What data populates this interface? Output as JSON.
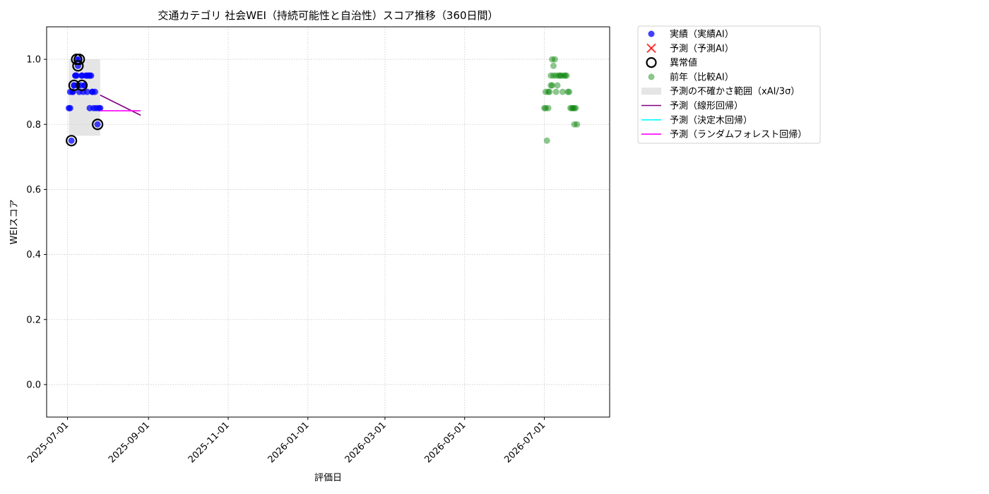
{
  "chart_data": {
    "type": "scatter",
    "title": "交通カテゴリ 社会WEI（持続可能性と自治性）スコア推移（360日間）",
    "xlabel": "評価日",
    "ylabel": "WEIスコア",
    "x_range": [
      "2025-06-15",
      "2026-08-20"
    ],
    "ylim": [
      -0.1,
      1.1
    ],
    "y_ticks": [
      0.0,
      0.2,
      0.4,
      0.6,
      0.8,
      1.0
    ],
    "y_tick_labels": [
      "0.0",
      "0.2",
      "0.4",
      "0.6",
      "0.8",
      "1.0"
    ],
    "x_ticks": [
      "2025-07-01",
      "2025-09-01",
      "2025-11-01",
      "2026-01-01",
      "2026-03-01",
      "2026-05-01",
      "2026-07-01"
    ],
    "grid": true,
    "legend_position": "outside-right",
    "legend": [
      {
        "key": "actual",
        "label": "実績（実績AI）",
        "marker": "dot",
        "color": "#0000ff"
      },
      {
        "key": "forecast",
        "label": "予測（予測AI）",
        "marker": "x",
        "color": "#ff0000"
      },
      {
        "key": "anomaly",
        "label": "異常値",
        "marker": "ring",
        "color": "#000000"
      },
      {
        "key": "prev_year",
        "label": "前年（比較AI）",
        "marker": "dot",
        "color": "#008000"
      },
      {
        "key": "band",
        "label": "予測の不確かさ範囲（xAI/3σ）",
        "marker": "rect",
        "color": "#d3d3d3"
      },
      {
        "key": "linear",
        "label": "予測（線形回帰）",
        "marker": "line",
        "color": "#800080"
      },
      {
        "key": "tree",
        "label": "予測（決定木回帰）",
        "marker": "line",
        "color": "#00ffff"
      },
      {
        "key": "forest",
        "label": "予測（ランダムフォレスト回帰）",
        "marker": "line",
        "color": "#ff00ff"
      }
    ],
    "series": [
      {
        "key": "actual",
        "name": "実績（実績AI）",
        "color": "#0000ff",
        "x": [
          "2025-07-02",
          "2025-07-03",
          "2025-07-04",
          "2025-07-05",
          "2025-07-06",
          "2025-07-07",
          "2025-07-08",
          "2025-07-09",
          "2025-07-10",
          "2025-07-11",
          "2025-07-12",
          "2025-07-13",
          "2025-07-14",
          "2025-07-15",
          "2025-07-16",
          "2025-07-17",
          "2025-07-18",
          "2025-07-19",
          "2025-07-20",
          "2025-07-21",
          "2025-07-22",
          "2025-07-23",
          "2025-07-24",
          "2025-07-25",
          "2025-07-26",
          "2025-07-03",
          "2025-07-05",
          "2025-07-06",
          "2025-07-07",
          "2025-07-08",
          "2025-07-09",
          "2025-07-10",
          "2025-07-12",
          "2025-07-14",
          "2025-07-16",
          "2025-07-18",
          "2025-07-20"
        ],
        "y": [
          0.85,
          0.9,
          0.75,
          0.9,
          0.92,
          0.95,
          1.0,
          0.98,
          1.0,
          0.92,
          0.95,
          0.9,
          0.92,
          0.95,
          0.9,
          0.95,
          0.95,
          0.95,
          0.9,
          0.85,
          0.9,
          0.85,
          0.8,
          0.85,
          0.85,
          0.85,
          0.9,
          0.92,
          0.95,
          0.95,
          0.92,
          0.9,
          0.95,
          0.92,
          0.95,
          0.85,
          0.9
        ]
      },
      {
        "key": "anomaly",
        "name": "異常値",
        "color": "#000000",
        "x": [
          "2025-07-04",
          "2025-07-06",
          "2025-07-08",
          "2025-07-09",
          "2025-07-10",
          "2025-07-12",
          "2025-07-24"
        ],
        "y": [
          0.75,
          0.92,
          1.0,
          0.98,
          1.0,
          0.92,
          0.8
        ]
      },
      {
        "key": "prev_year",
        "name": "前年（比較AI）",
        "color": "#008000",
        "x": [
          "2026-07-01",
          "2026-07-02",
          "2026-07-02",
          "2026-07-03",
          "2026-07-04",
          "2026-07-04",
          "2026-07-05",
          "2026-07-06",
          "2026-07-06",
          "2026-07-07",
          "2026-07-07",
          "2026-07-08",
          "2026-07-08",
          "2026-07-09",
          "2026-07-10",
          "2026-07-10",
          "2026-07-11",
          "2026-07-12",
          "2026-07-13",
          "2026-07-14",
          "2026-07-15",
          "2026-07-16",
          "2026-07-17",
          "2026-07-18",
          "2026-07-19",
          "2026-07-20",
          "2026-07-21",
          "2026-07-22",
          "2026-07-23",
          "2026-07-24",
          "2026-07-25",
          "2026-07-26",
          "2026-07-24"
        ],
        "y": [
          0.85,
          0.9,
          0.85,
          0.75,
          0.9,
          0.85,
          0.9,
          0.92,
          0.95,
          1.0,
          0.92,
          0.98,
          0.95,
          1.0,
          0.95,
          0.9,
          0.92,
          0.95,
          0.95,
          0.95,
          0.9,
          0.95,
          0.95,
          0.95,
          0.9,
          0.9,
          0.85,
          0.85,
          0.85,
          0.8,
          0.85,
          0.8,
          0.85
        ]
      }
    ],
    "band": {
      "x_start": "2025-07-02",
      "x_end": "2025-07-26",
      "y_low": 0.765,
      "y_high": 1.0
    },
    "lines": [
      {
        "key": "linear",
        "name": "予測（線形回帰）",
        "color": "#800080",
        "x": [
          "2025-07-26",
          "2025-08-26"
        ],
        "y": [
          0.89,
          0.828
        ]
      },
      {
        "key": "forest",
        "name": "予測（ランダムフォレスト回帰）",
        "color": "#ff00ff",
        "x": [
          "2025-07-26",
          "2025-08-26"
        ],
        "y": [
          0.842,
          0.842
        ]
      }
    ]
  }
}
